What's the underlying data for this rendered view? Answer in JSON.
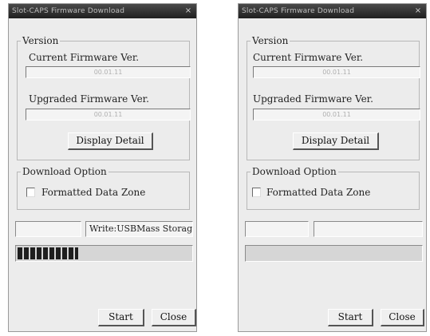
{
  "windows": [
    {
      "title": "Slot-CAPS Firmware Download",
      "close_glyph": "×",
      "version_group_label": "Version",
      "current_label": "Current Firmware Ver.",
      "current_value": "00.01.11",
      "upgraded_label": "Upgraded Firmware Ver.",
      "upgraded_value": "00.01.11",
      "display_detail_label": "Display Detail",
      "download_group_label": "Download Option",
      "formatted_label": "Formatted Data Zone",
      "formatted_checked": false,
      "status_left": "",
      "status_right": "Write:USBMass Storage",
      "progress_fraction": 0.35,
      "start_label": "Start",
      "close_label": "Close"
    },
    {
      "title": "Slot-CAPS Firmware Download",
      "close_glyph": "×",
      "version_group_label": "Version",
      "current_label": "Current Firmware Ver.",
      "current_value": "00.01.11",
      "upgraded_label": "Upgraded Firmware Ver.",
      "upgraded_value": "00.01.11",
      "display_detail_label": "Display Detail",
      "download_group_label": "Download Option",
      "formatted_label": "Formatted Data Zone",
      "formatted_checked": false,
      "status_left": "",
      "status_right": "",
      "progress_fraction": 0,
      "start_label": "Start",
      "close_label": "Close"
    }
  ]
}
